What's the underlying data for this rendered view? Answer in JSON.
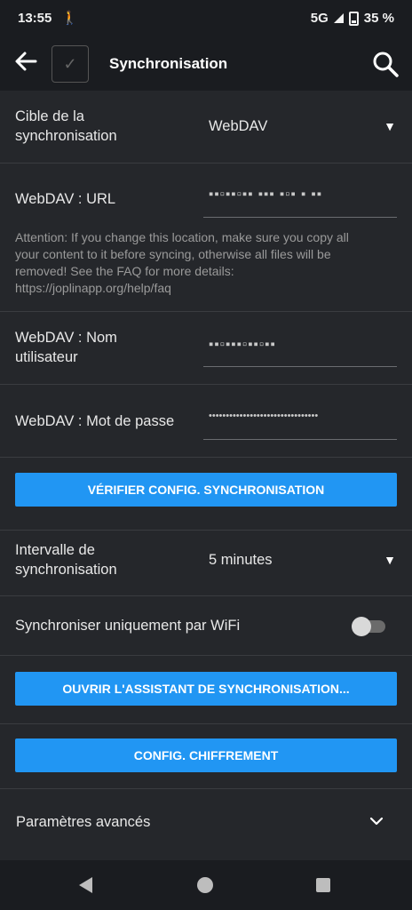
{
  "status_bar": {
    "time": "13:55",
    "network": "5G",
    "battery": "35 %"
  },
  "top_bar": {
    "title": "Synchronisation"
  },
  "sync_target": {
    "label": "Cible de la synchronisation",
    "value": "WebDAV"
  },
  "webdav_url": {
    "label": "WebDAV : URL",
    "hint": "Attention: If you change this location, make sure you copy all your content to it before syncing, otherwise all files will be removed! See the FAQ for more details: https://joplinapp.org/help/faq"
  },
  "webdav_username": {
    "label": "WebDAV : Nom utilisateur"
  },
  "webdav_password": {
    "label": "WebDAV : Mot de passe",
    "value": "••••••••••••••••••••••••••••••••"
  },
  "buttons": {
    "check_config": "VÉRIFIER CONFIG. SYNCHRONISATION",
    "open_wizard": "OUVRIR L'ASSISTANT DE SYNCHRONISATION...",
    "encryption_config": "CONFIG. CHIFFREMENT"
  },
  "sync_interval": {
    "label": "Intervalle de synchronisation",
    "value": "5 minutes"
  },
  "wifi_only": {
    "label": "Synchroniser uniquement par WiFi",
    "enabled": false
  },
  "advanced": {
    "label": "Paramètres avancés"
  },
  "colors": {
    "accent": "#2196f3",
    "background": "#25272b",
    "bars": "#1a1c20"
  }
}
